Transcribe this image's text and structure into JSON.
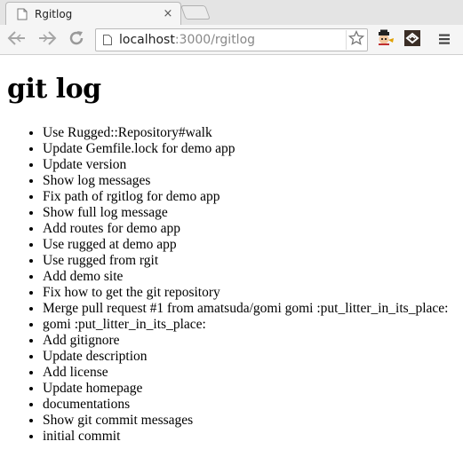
{
  "browser": {
    "tab_title": "Rgitlog",
    "tab_close_symbol": "×",
    "url_host": "localhost",
    "url_rest": ":3000/rgitlog",
    "icons": [
      "page-icon",
      "back-icon",
      "forward-icon",
      "reload-icon",
      "star-icon",
      "extension-icon",
      "extension-icon",
      "menu-icon"
    ]
  },
  "page": {
    "heading": "git log",
    "commits": [
      "Use Rugged::Repository#walk",
      "Update Gemfile.lock for demo app",
      "Update version",
      "Show log messages",
      "Fix path of rgitlog for demo app",
      "Show full log message",
      "Add routes for demo app",
      "Use rugged at demo app",
      "Use rugged from rgit",
      "Add demo site",
      "Fix how to get the git repository",
      "Merge pull request #1 from amatsuda/gomi gomi :put_litter_in_its_place:",
      "gomi :put_litter_in_its_place:",
      "Add gitignore",
      "Update description",
      "Add license",
      "Update homepage",
      "documentations",
      "Show git commit messages",
      "initial commit"
    ]
  }
}
